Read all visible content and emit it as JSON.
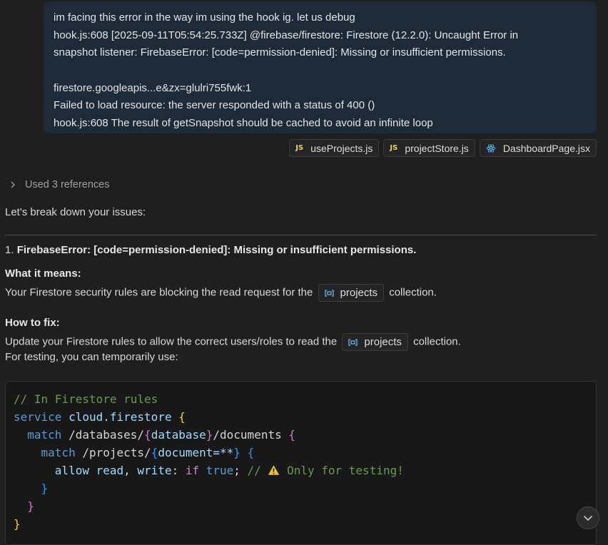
{
  "user_message": {
    "lines": [
      "im facing this error in the way im using the hook ig. let us debug",
      "hook.js:608 [2025-09-11T05:54:25.733Z] @firebase/firestore: Firestore (12.2.0): Uncaught Error in",
      "snapshot listener: FirebaseError: [code=permission-denied]: Missing or insufficient permissions.",
      "firestore.googleapis...e&zx=glulri755fwk:1",
      "Failed to load resource: the server responded with a status of 400 ()",
      "hook.js:608 The result of getSnapshot should be cached to avoid an infinite loop"
    ]
  },
  "attachments": [
    {
      "label": "useProjects.js",
      "icon": "js-file-icon"
    },
    {
      "label": "projectStore.js",
      "icon": "js-file-icon"
    },
    {
      "label": "DashboardPage.jsx",
      "icon": "react-file-icon"
    }
  ],
  "js_badge": "JS",
  "used_references": "Used 3 references",
  "response": {
    "intro": "Let's break down your issues:",
    "item_number": "1.",
    "item_title": "FirebaseError: [code=permission-denied]: Missing or insufficient permissions.",
    "what_heading": "What it means:",
    "what_text_before": "Your Firestore security rules are blocking the read request for the",
    "symbol": "projects",
    "what_text_after": "collection.",
    "how_heading": "How to fix:",
    "how_text_before": "Update your Firestore rules to allow the correct users/roles to read the",
    "how_text_after": "collection.",
    "testing_text": "For testing, you can temporarily use:"
  },
  "code": {
    "comment1": "// In Firestore rules",
    "kw_service": "service",
    "service_name": "cloud.firestore",
    "kw_match": "match",
    "path1a": "/databases/",
    "var_database": "database",
    "path1b": "/documents",
    "path2a": "/projects/",
    "var_document": "document=**",
    "allow": "allow",
    "read": "read",
    "write": "write",
    "kw_if": "if",
    "kw_true": "true",
    "comment2_prefix": "//",
    "comment2_text": "Only for testing!"
  },
  "colors": {
    "background": "#1f1f1f",
    "user_bubble": "#1e2a37",
    "js_badge": "#e8d44d",
    "react_icon": "#4fc3f7",
    "warning": "#f5c518"
  }
}
